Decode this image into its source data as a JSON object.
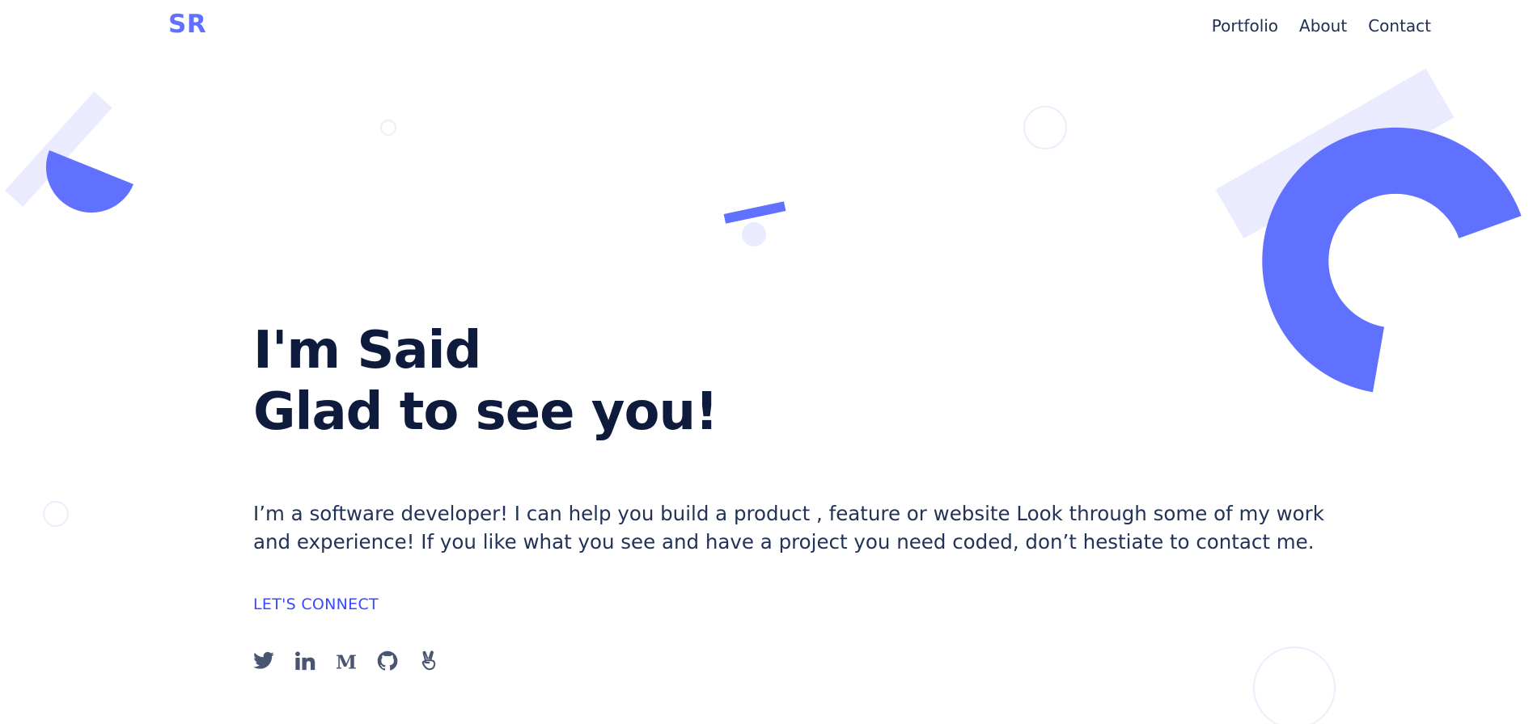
{
  "header": {
    "logo_text": "SR",
    "nav": [
      {
        "label": "Portfolio"
      },
      {
        "label": "About"
      },
      {
        "label": "Contact"
      }
    ]
  },
  "hero": {
    "line1": "I'm Said",
    "line2": "Glad to see you!",
    "intro": "I’m a software developer! I can help you build a product , feature or website Look through some of my work and experience! If you like what you see and have a project you need coded, don’t hestiate to contact me.",
    "cta_label": "LET'S CONNECT"
  },
  "socials": [
    {
      "icon": "twitter-icon"
    },
    {
      "icon": "linkedin-icon"
    },
    {
      "icon": "medium-icon"
    },
    {
      "icon": "github-icon"
    },
    {
      "icon": "angellist-icon"
    }
  ],
  "colors": {
    "accent": "#6171ff",
    "accent_light": "#eaebfe",
    "heading": "#0f1b3d",
    "body_text": "#223357",
    "cta": "#3a48ff",
    "icon": "#4a5573"
  }
}
